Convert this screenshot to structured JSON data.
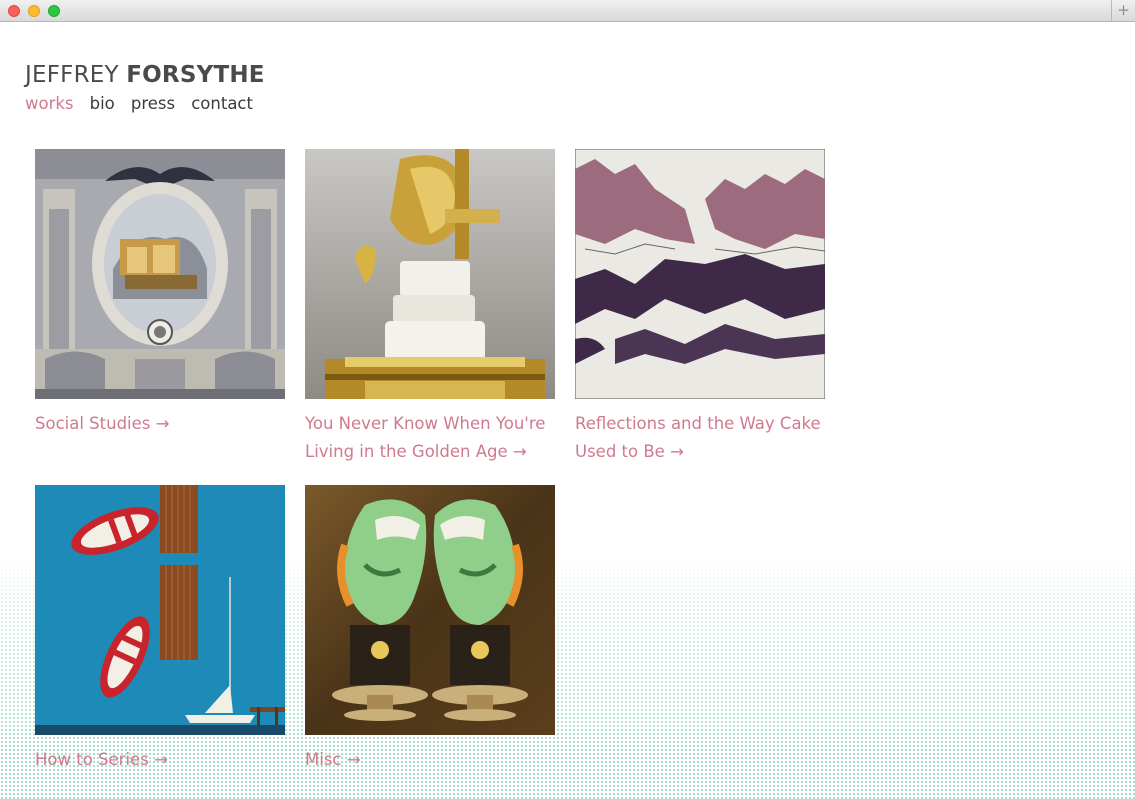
{
  "window": {
    "new_tab_symbol": "+"
  },
  "site": {
    "title_first": "JEFFREY",
    "title_last": "FORSYTHE"
  },
  "nav": [
    {
      "label": "works",
      "active": true
    },
    {
      "label": "bio",
      "active": false
    },
    {
      "label": "press",
      "active": false
    },
    {
      "label": "contact",
      "active": false
    }
  ],
  "arrow": "→",
  "works": [
    {
      "title": "Social Studies",
      "icon": "ornate-film-logo-painting"
    },
    {
      "title": "You Never Know When You're Living in the Golden Age",
      "icon": "gold-cake-sculpture"
    },
    {
      "title": "Reflections and the Way Cake Used to Be",
      "icon": "ink-landscape-drawing"
    },
    {
      "title": "How to Series",
      "icon": "rowboats-painting"
    },
    {
      "title": "Misc",
      "icon": "foo-dogs-painting"
    }
  ],
  "colors": {
    "accent": "#cf7a8e",
    "text": "#3c3c3c",
    "halftone": "#a9dccb"
  }
}
